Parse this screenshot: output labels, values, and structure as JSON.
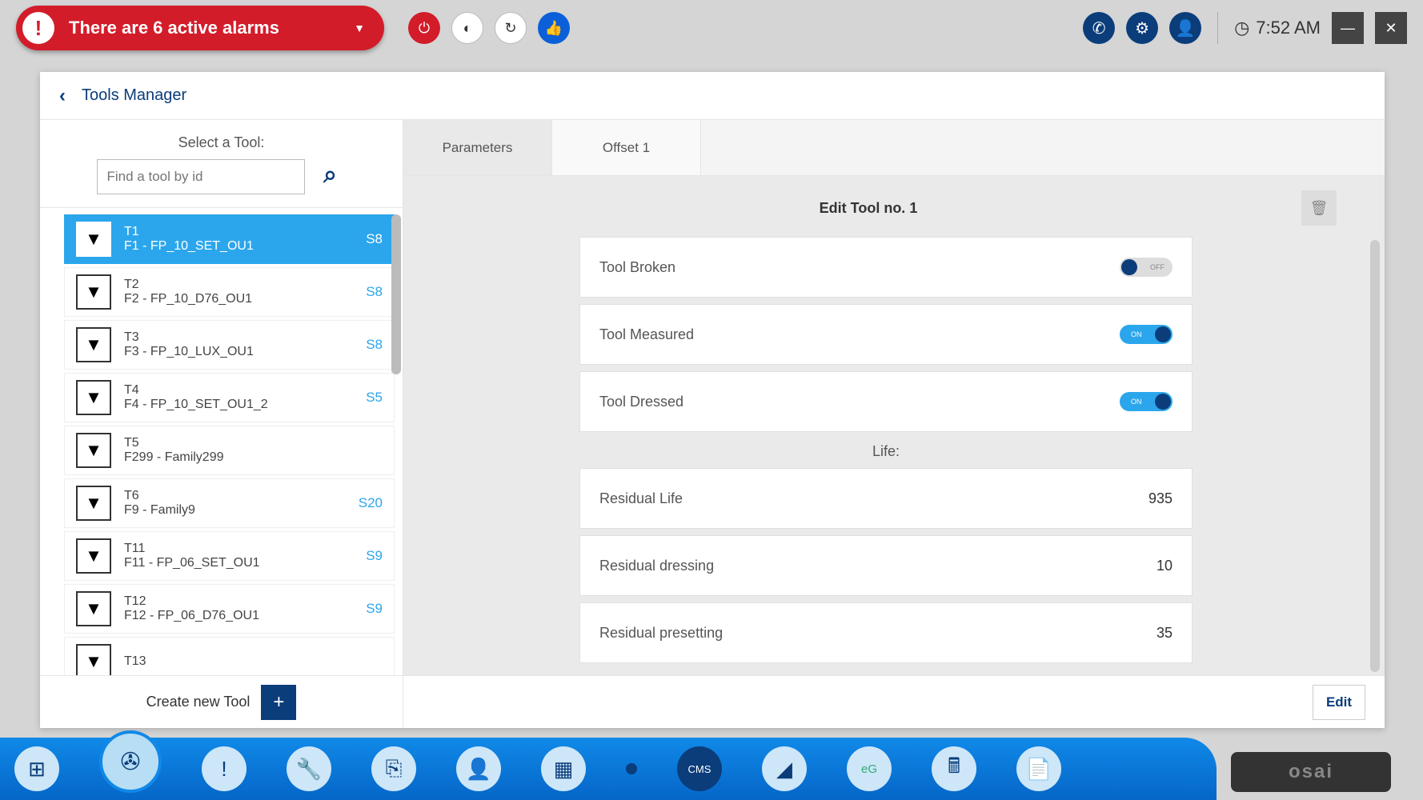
{
  "topbar": {
    "alarm_text": "There are 6 active alarms",
    "time": "7:52 AM"
  },
  "page_title": "Tools Manager",
  "sidebar": {
    "select_label": "Select a Tool:",
    "search_placeholder": "Find a tool by id",
    "create_label": "Create new Tool",
    "items": [
      {
        "id": "T1",
        "fam": "F1 - FP_10_SET_OU1",
        "slot": "S8",
        "selected": true
      },
      {
        "id": "T2",
        "fam": "F2 - FP_10_D76_OU1",
        "slot": "S8"
      },
      {
        "id": "T3",
        "fam": "F3 - FP_10_LUX_OU1",
        "slot": "S8"
      },
      {
        "id": "T4",
        "fam": "F4 - FP_10_SET_OU1_2",
        "slot": "S5"
      },
      {
        "id": "T5",
        "fam": "F299 - Family299",
        "slot": ""
      },
      {
        "id": "T6",
        "fam": "F9 - Family9",
        "slot": "S20"
      },
      {
        "id": "T11",
        "fam": "F11 - FP_06_SET_OU1",
        "slot": "S9"
      },
      {
        "id": "T12",
        "fam": "F12 - FP_06_D76_OU1",
        "slot": "S9"
      },
      {
        "id": "T13",
        "fam": "",
        "slot": ""
      }
    ]
  },
  "tabs": {
    "parameters": "Parameters",
    "offset": "Offset 1"
  },
  "panel": {
    "title": "Edit Tool no. 1",
    "tool_broken": {
      "label": "Tool Broken",
      "state": "OFF"
    },
    "tool_measured": {
      "label": "Tool Measured",
      "state": "ON"
    },
    "tool_dressed": {
      "label": "Tool Dressed",
      "state": "ON"
    },
    "life_label": "Life:",
    "residual_life": {
      "label": "Residual Life",
      "value": "935"
    },
    "residual_dressing": {
      "label": "Residual dressing",
      "value": "10"
    },
    "residual_presetting": {
      "label": "Residual presetting",
      "value": "35"
    },
    "edit_btn": "Edit"
  },
  "brand": "osai"
}
